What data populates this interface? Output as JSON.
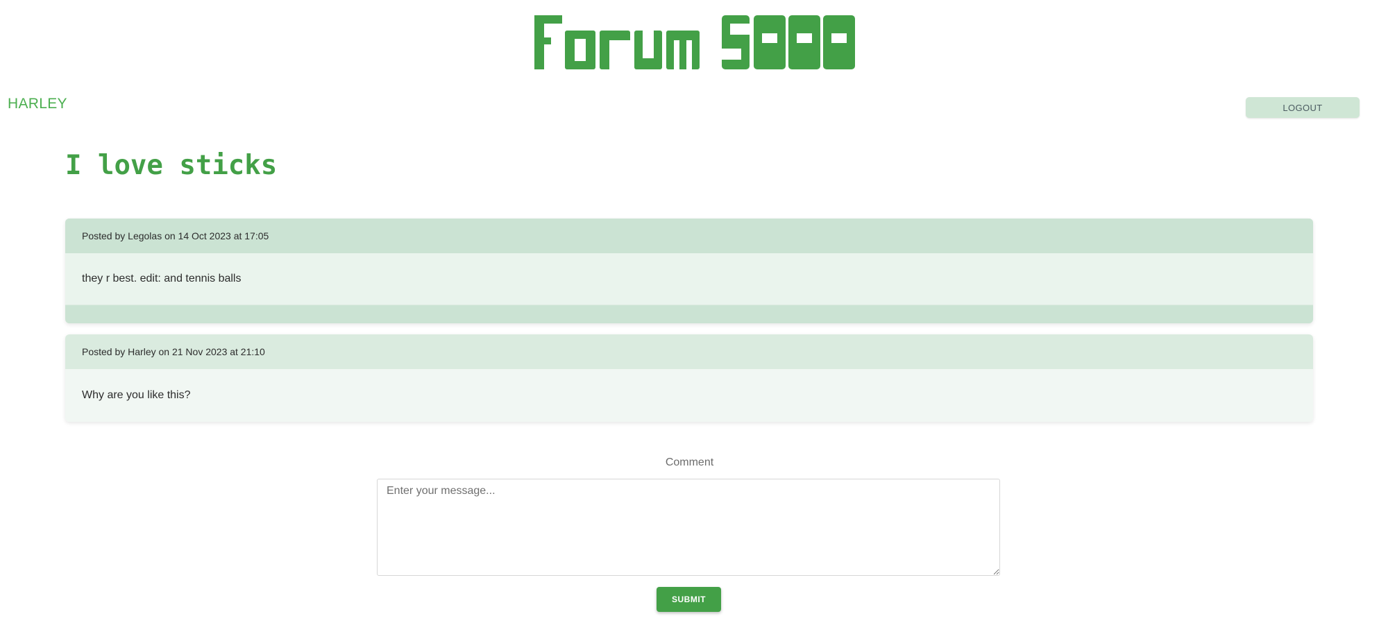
{
  "app": {
    "logo_text": "Forum 5000",
    "brand_color": "#43a047"
  },
  "header": {
    "username": "HARLEY",
    "logout_label": "LOGOUT"
  },
  "thread": {
    "title": "I love sticks",
    "posts": [
      {
        "meta": "Posted by Legolas on 14 Oct 2023 at 17:05",
        "body": "they r best. edit: and tennis balls"
      },
      {
        "meta": "Posted by Harley on 21 Nov 2023 at 21:10",
        "body": "Why are you like this?"
      }
    ]
  },
  "comment_form": {
    "label": "Comment",
    "placeholder": "Enter your message...",
    "value": "",
    "submit_label": "SUBMIT"
  }
}
